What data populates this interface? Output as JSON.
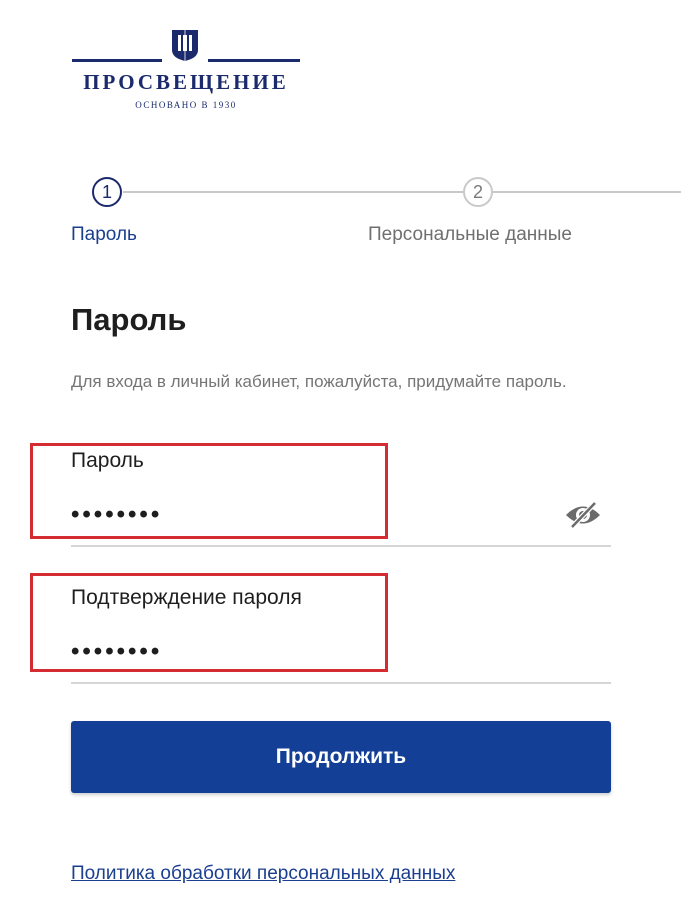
{
  "brand": {
    "name": "ПРОСВЕЩЕНИЕ",
    "tagline": "ОСНОВАНО В 1930",
    "color": "#1a2a6c"
  },
  "stepper": {
    "steps": [
      {
        "number": "1",
        "label": "Пароль",
        "state": "active"
      },
      {
        "number": "2",
        "label": "Персональные данные",
        "state": "inactive"
      }
    ]
  },
  "form": {
    "title": "Пароль",
    "description": "Для входа в личный кабинет, пожалуйста, придумайте пароль.",
    "password": {
      "label": "Пароль",
      "value": "••••••••"
    },
    "confirm": {
      "label": "Подтверждение пароля",
      "value": "••••••••"
    },
    "visibility_icon": "eye-slash-icon",
    "submit_label": "Продолжить"
  },
  "footer": {
    "policy_link": "Политика обработки персональных данных"
  },
  "colors": {
    "accent": "#133f96",
    "highlight": "#d42c32",
    "link": "#1b3f8f"
  }
}
